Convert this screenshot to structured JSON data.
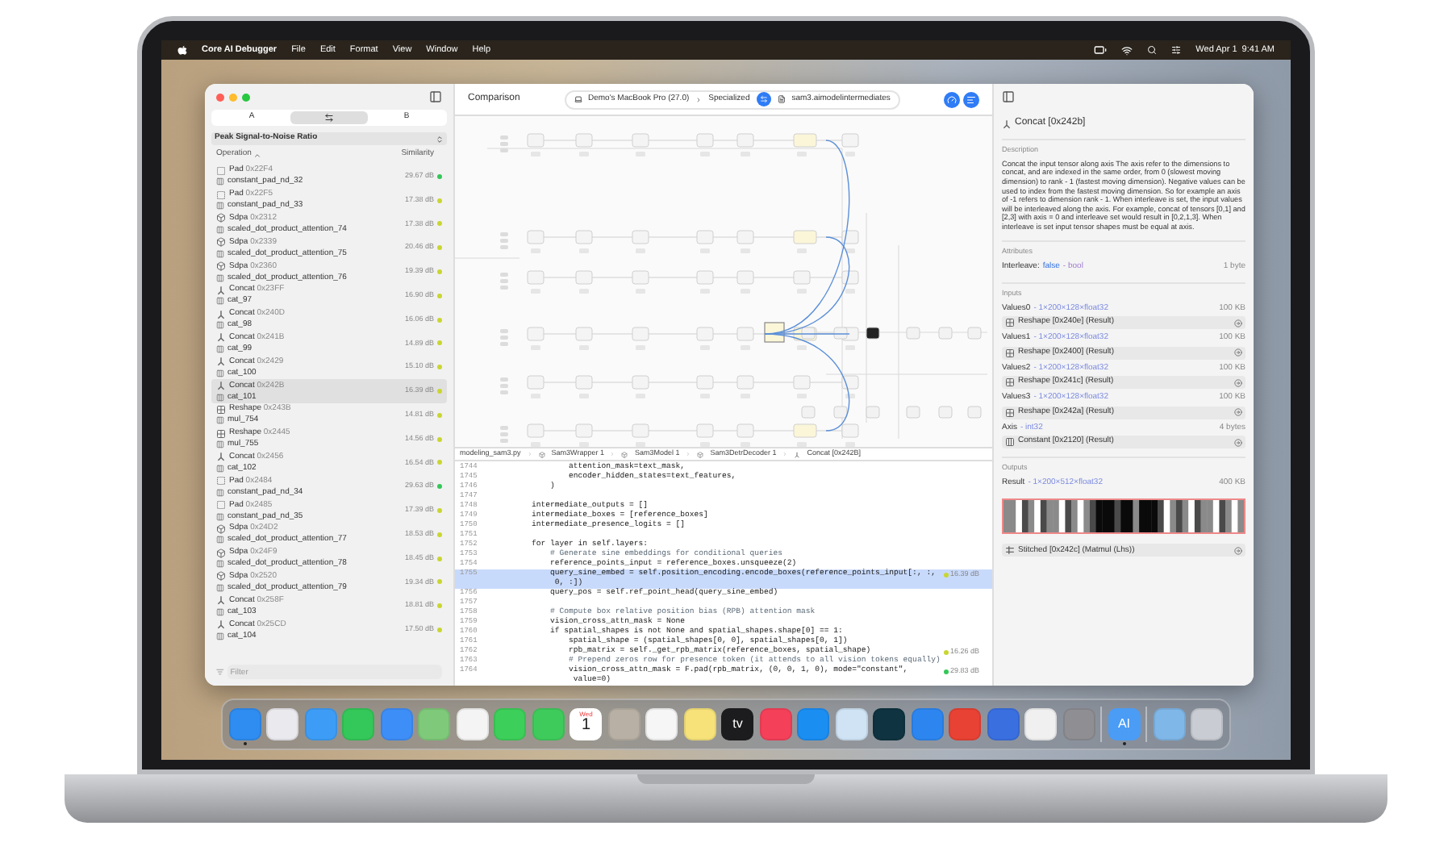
{
  "menubar": {
    "app": "Core AI Debugger",
    "menus": [
      "File",
      "Edit",
      "Format",
      "View",
      "Window",
      "Help"
    ],
    "clock": "Wed Apr 1  9:41 AM"
  },
  "sidebar": {
    "segments": [
      {
        "kind": "text",
        "label": "A",
        "selected": false
      },
      {
        "kind": "icon",
        "selected": true
      },
      {
        "kind": "text",
        "label": "B",
        "selected": false
      }
    ],
    "metric": "Peak Signal-to-Noise Ratio",
    "columns": [
      "Operation",
      "Similarity"
    ],
    "rows": [
      {
        "kind": "pad",
        "op": "Pad",
        "addr": "0x22F4",
        "name": "constant_pad_nd_32",
        "value": "29.67 dB",
        "color": "#34c759",
        "selected": false
      },
      {
        "kind": "pad",
        "op": "Pad",
        "addr": "0x22F5",
        "name": "constant_pad_nd_33",
        "value": "17.38 dB",
        "color": "#c9d631",
        "selected": false
      },
      {
        "kind": "sdpa",
        "op": "Sdpa",
        "addr": "0x2312",
        "name": "scaled_dot_product_attention_74",
        "value": "17.38 dB",
        "color": "#c9d631",
        "selected": false
      },
      {
        "kind": "sdpa",
        "op": "Sdpa",
        "addr": "0x2339",
        "name": "scaled_dot_product_attention_75",
        "value": "20.46 dB",
        "color": "#c9d631",
        "selected": false
      },
      {
        "kind": "sdpa",
        "op": "Sdpa",
        "addr": "0x2360",
        "name": "scaled_dot_product_attention_76",
        "value": "19.39 dB",
        "color": "#c9d631",
        "selected": false
      },
      {
        "kind": "concat",
        "op": "Concat",
        "addr": "0x23FF",
        "name": "cat_97",
        "value": "16.90 dB",
        "color": "#c9d631",
        "selected": false
      },
      {
        "kind": "concat",
        "op": "Concat",
        "addr": "0x240D",
        "name": "cat_98",
        "value": "16.06 dB",
        "color": "#c9d631",
        "selected": false
      },
      {
        "kind": "concat",
        "op": "Concat",
        "addr": "0x241B",
        "name": "cat_99",
        "value": "14.89 dB",
        "color": "#c9d631",
        "selected": false
      },
      {
        "kind": "concat",
        "op": "Concat",
        "addr": "0x2429",
        "name": "cat_100",
        "value": "15.10 dB",
        "color": "#c9d631",
        "selected": false
      },
      {
        "kind": "concat",
        "op": "Concat",
        "addr": "0x242B",
        "name": "cat_101",
        "value": "16.39 dB",
        "color": "#c9d631",
        "selected": true
      },
      {
        "kind": "reshape",
        "op": "Reshape",
        "addr": "0x243B",
        "name": "mul_754",
        "value": "14.81 dB",
        "color": "#c9d631",
        "selected": false
      },
      {
        "kind": "reshape",
        "op": "Reshape",
        "addr": "0x2445",
        "name": "mul_755",
        "value": "14.56 dB",
        "color": "#c9d631",
        "selected": false
      },
      {
        "kind": "concat",
        "op": "Concat",
        "addr": "0x2456",
        "name": "cat_102",
        "value": "16.54 dB",
        "color": "#c9d631",
        "selected": false
      },
      {
        "kind": "pad",
        "op": "Pad",
        "addr": "0x2484",
        "name": "constant_pad_nd_34",
        "value": "29.63 dB",
        "color": "#34c759",
        "selected": false
      },
      {
        "kind": "pad",
        "op": "Pad",
        "addr": "0x2485",
        "name": "constant_pad_nd_35",
        "value": "17.39 dB",
        "color": "#c9d631",
        "selected": false
      },
      {
        "kind": "sdpa",
        "op": "Sdpa",
        "addr": "0x24D2",
        "name": "scaled_dot_product_attention_77",
        "value": "18.53 dB",
        "color": "#c9d631",
        "selected": false
      },
      {
        "kind": "sdpa",
        "op": "Sdpa",
        "addr": "0x24F9",
        "name": "scaled_dot_product_attention_78",
        "value": "18.45 dB",
        "color": "#c9d631",
        "selected": false
      },
      {
        "kind": "sdpa",
        "op": "Sdpa",
        "addr": "0x2520",
        "name": "scaled_dot_product_attention_79",
        "value": "19.34 dB",
        "color": "#c9d631",
        "selected": false
      },
      {
        "kind": "concat",
        "op": "Concat",
        "addr": "0x258F",
        "name": "cat_103",
        "value": "18.81 dB",
        "color": "#c9d631",
        "selected": false
      },
      {
        "kind": "concat",
        "op": "Concat",
        "addr": "0x25CD",
        "name": "cat_104",
        "value": "17.50 dB",
        "color": "#c9d631",
        "selected": false
      }
    ],
    "filter": {
      "placeholder": "Filter"
    }
  },
  "toolbar": {
    "title": "Comparison",
    "device": "Demo's MacBook Pro (27.0)",
    "mode": "Specialized",
    "file": "sam3.aimodelintermediates"
  },
  "breadcrumbs": [
    {
      "kind": "file",
      "label": "modeling_sam3.py"
    },
    {
      "kind": "module",
      "label": "Sam3Wrapper 1"
    },
    {
      "kind": "module",
      "label": "Sam3Model 1"
    },
    {
      "kind": "module",
      "label": "Sam3DetrDecoder 1"
    },
    {
      "kind": "op",
      "label": "Concat [0x242B]"
    }
  ],
  "code": [
    {
      "num": "1744",
      "kind": "code",
      "text": "            attention_mask=text_mask,",
      "selected": false
    },
    {
      "num": "1745",
      "kind": "code",
      "text": "            encoder_hidden_states=text_features,",
      "selected": false
    },
    {
      "num": "1746",
      "kind": "code",
      "text": "        )",
      "selected": false
    },
    {
      "num": "1747",
      "kind": "code",
      "selected": false
    },
    {
      "num": "1748",
      "kind": "code",
      "text": "    intermediate_outputs = []",
      "selected": false
    },
    {
      "num": "1749",
      "kind": "code",
      "text": "    intermediate_boxes = [reference_boxes]",
      "selected": false
    },
    {
      "num": "1750",
      "kind": "code",
      "text": "    intermediate_presence_logits = []",
      "selected": false
    },
    {
      "num": "1751",
      "kind": "code",
      "selected": false
    },
    {
      "num": "1752",
      "kind": "code",
      "text": "    for layer in self.layers:",
      "selected": false
    },
    {
      "num": "1753",
      "kind": "comment",
      "text": "        # Generate sine embeddings for conditional queries",
      "selected": false
    },
    {
      "num": "1754",
      "kind": "code",
      "text": "        reference_points_input = reference_boxes.unsqueeze(2)",
      "selected": false
    },
    {
      "num": "1755",
      "kind": "code",
      "text": "        query_sine_embed = self.position_encoding.encode_boxes(reference_points_input[:, :,\n         0, :])",
      "selected": true,
      "note": "16.39 dB",
      "color": "#c9d631"
    },
    {
      "num": "1756",
      "kind": "code",
      "text": "        query_pos = self.ref_point_head(query_sine_embed)",
      "selected": false
    },
    {
      "num": "1757",
      "kind": "code",
      "selected": false
    },
    {
      "num": "1758",
      "kind": "comment",
      "text": "        # Compute box relative position bias (RPB) attention mask",
      "selected": false
    },
    {
      "num": "1759",
      "kind": "code",
      "text": "        vision_cross_attn_mask = None",
      "selected": false
    },
    {
      "num": "1760",
      "kind": "code",
      "text": "        if spatial_shapes is not None and spatial_shapes.shape[0] == 1:",
      "selected": false
    },
    {
      "num": "1761",
      "kind": "code",
      "text": "            spatial_shape = (spatial_shapes[0, 0], spatial_shapes[0, 1])",
      "selected": false
    },
    {
      "num": "1762",
      "kind": "code",
      "text": "            rpb_matrix = self._get_rpb_matrix(reference_boxes, spatial_shape)",
      "selected": false,
      "note": "16.26 dB",
      "color": "#c9d631"
    },
    {
      "num": "1763",
      "kind": "comment",
      "text": "            # Prepend zeros row for presence token (it attends to all vision tokens equally)",
      "selected": false
    },
    {
      "num": "1764",
      "kind": "code",
      "text": "            vision_cross_attn_mask = F.pad(rpb_matrix, (0, 0, 1, 0), mode=\"constant\",\n             value=0)",
      "selected": false,
      "note": "29.83 dB",
      "color": "#34c759"
    }
  ],
  "inspector": {
    "title": "Concat [0x242b]",
    "description_heading": "Description",
    "description": "Concat the input tensor along axis The axis refer to the dimensions to concat, and are indexed in the same order, from 0 (slowest moving dimension) to rank - 1 (fastest moving dimension). Negative values can be used to index from the fastest moving dimension. So for example an axis of -1 refers to dimension rank - 1. When interleave is set, the input values will be interleaved along the axis. For example, concat of tensors [0,1] and [2,3] with axis = 0 and interleave set would result in [0,2,1,3]. When interleave is set input tensor shapes must be equal at axis.",
    "attributes_heading": "Attributes",
    "attributes": [
      {
        "name": "Interleave:",
        "value": "false",
        "type": "- bool",
        "size": "1 byte"
      }
    ],
    "inputs_heading": "Inputs",
    "inputs": [
      {
        "name": "Values0",
        "type": "- 1×200×128×float32",
        "size": "100 KB",
        "kind": "reshape",
        "source": "Reshape [0x240e] (Result)"
      },
      {
        "name": "Values1",
        "type": "- 1×200×128×float32",
        "size": "100 KB",
        "kind": "reshape",
        "source": "Reshape [0x2400] (Result)"
      },
      {
        "name": "Values2",
        "type": "- 1×200×128×float32",
        "size": "100 KB",
        "kind": "reshape",
        "source": "Reshape [0x241c] (Result)"
      },
      {
        "name": "Values3",
        "type": "- 1×200×128×float32",
        "size": "100 KB",
        "kind": "reshape",
        "source": "Reshape [0x242a] (Result)"
      },
      {
        "name": "Axis",
        "type": "- int32",
        "size": "4 bytes",
        "kind": "constant",
        "source": "Constant [0x2120] (Result)"
      }
    ],
    "outputs_heading": "Outputs",
    "outputs": [
      {
        "name": "Result",
        "type": "- 1×200×512×float32",
        "size": "400 KB",
        "kind": "matmul",
        "source": "Stitched [0x242c] (Matmul (Lhs))"
      }
    ]
  },
  "dock": [
    {
      "kind": "app",
      "color": "#2f8cf0",
      "running": true
    },
    {
      "kind": "app",
      "color": "#e9e9ee",
      "running": false
    },
    {
      "kind": "app",
      "color": "#3d9df6",
      "running": false
    },
    {
      "kind": "app",
      "color": "#34c759",
      "running": false
    },
    {
      "kind": "app",
      "color": "#3e8ef7",
      "running": false
    },
    {
      "kind": "app",
      "color": "#7fc97a",
      "running": false
    },
    {
      "kind": "app",
      "color": "#f4f4f4",
      "running": false
    },
    {
      "kind": "app",
      "color": "#3ccf5a",
      "running": false
    },
    {
      "kind": "app",
      "color": "#3fcb5c",
      "running": false
    },
    {
      "kind": "calendar",
      "day": "Wed",
      "date": "1",
      "running": false
    },
    {
      "kind": "app",
      "color": "#b8b0a4",
      "running": false
    },
    {
      "kind": "app",
      "color": "#f6f6f6",
      "running": false
    },
    {
      "kind": "app",
      "color": "#f7e27a",
      "running": false
    },
    {
      "kind": "label",
      "text": "tv",
      "color": "#1c1c1e",
      "running": false
    },
    {
      "kind": "app",
      "color": "#f5405a",
      "running": false
    },
    {
      "kind": "app",
      "color": "#1b8ef2",
      "running": false
    },
    {
      "kind": "app",
      "color": "#cfe3f5",
      "running": false
    },
    {
      "kind": "app",
      "color": "#0f3340",
      "running": false
    },
    {
      "kind": "app",
      "color": "#2d86f0",
      "running": false
    },
    {
      "kind": "app",
      "color": "#e84234",
      "running": false
    },
    {
      "kind": "app",
      "color": "#3a6fe0",
      "running": false
    },
    {
      "kind": "app",
      "color": "#f0f0f0",
      "running": false
    },
    {
      "kind": "app",
      "color": "#8e8e93",
      "running": false
    },
    {
      "kind": "separator"
    },
    {
      "kind": "label",
      "text": "AI",
      "color": "#4a9cf5",
      "running": true
    },
    {
      "kind": "separator"
    },
    {
      "kind": "app",
      "color": "#7fb7e8",
      "running": false
    },
    {
      "kind": "app",
      "color": "#c9ccd2",
      "running": false
    }
  ]
}
